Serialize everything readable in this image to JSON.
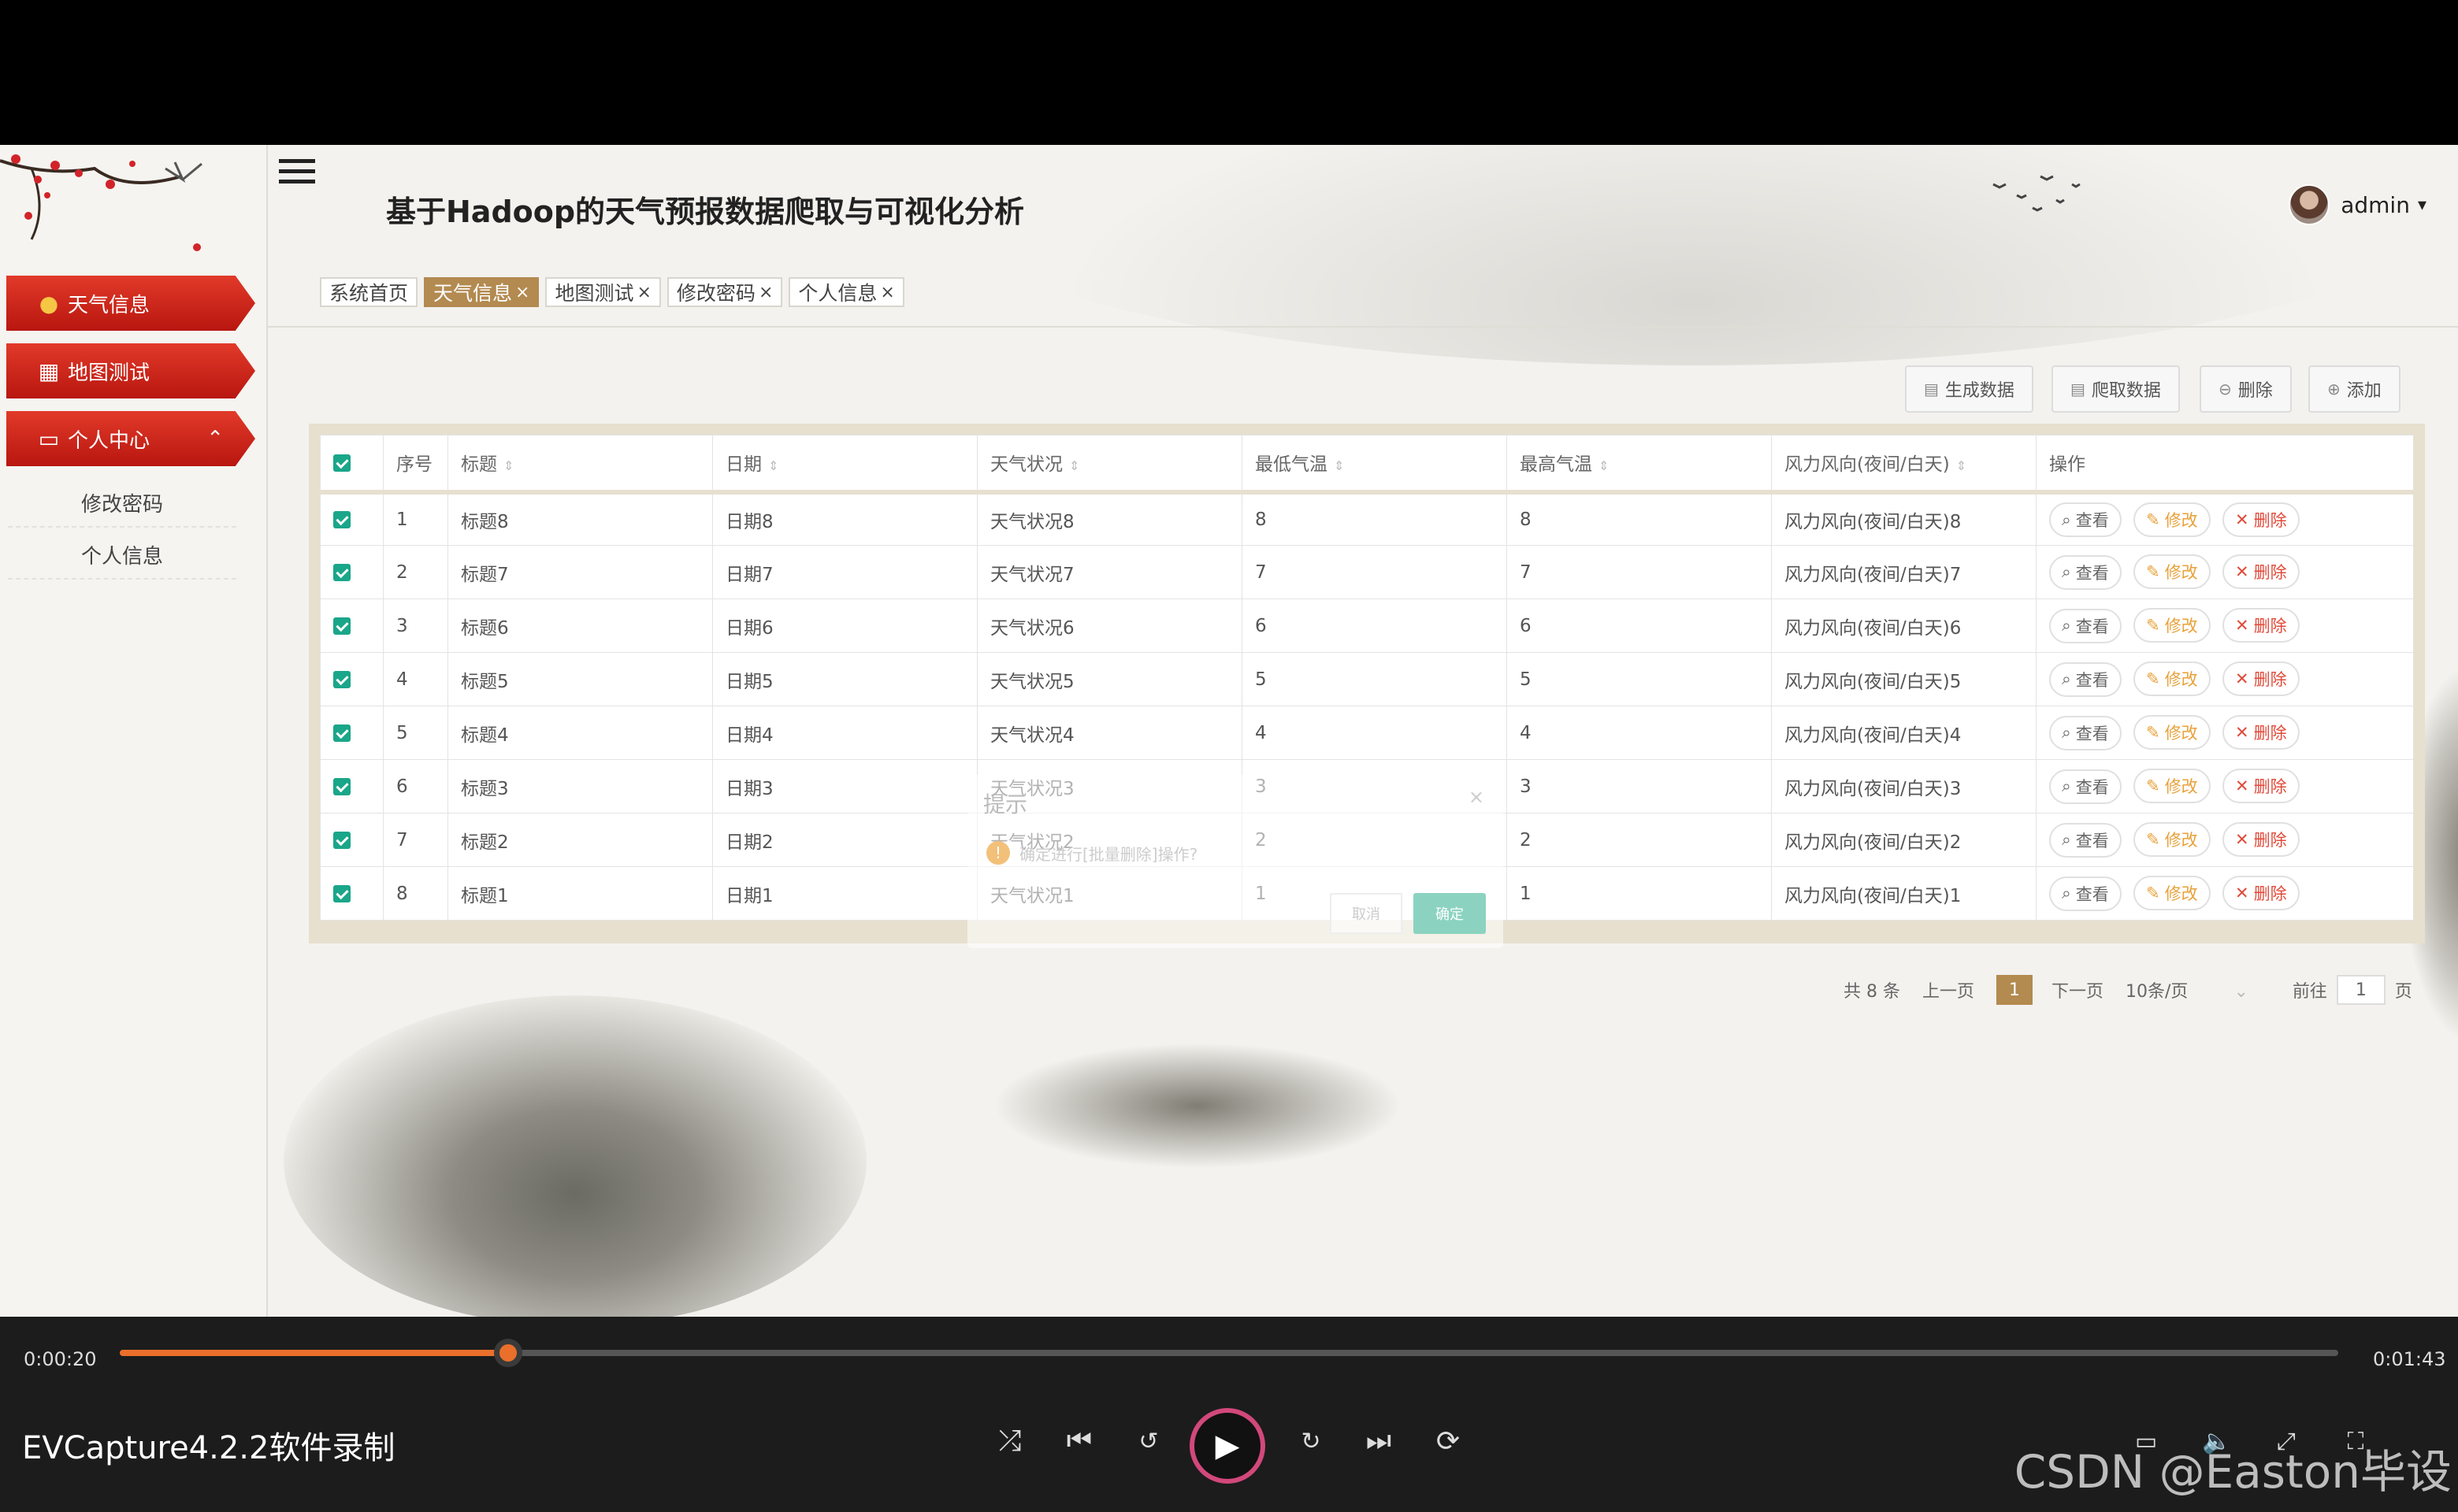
{
  "app_title": "基于Hadoop的天气预报数据爬取与可视化分析",
  "user": {
    "name": "admin",
    "dropdown_icon": "▾"
  },
  "sidebar": {
    "items": [
      {
        "label": "天气信息",
        "icon": "user-icon"
      },
      {
        "label": "地图测试",
        "icon": "grid-icon"
      },
      {
        "label": "个人中心",
        "icon": "calendar-icon",
        "arrow": "^"
      }
    ],
    "subitems": [
      {
        "label": "修改密码"
      },
      {
        "label": "个人信息"
      }
    ]
  },
  "tabs": [
    {
      "label": "系统首页",
      "closable": false
    },
    {
      "label": "天气信息",
      "closable": true,
      "active": true
    },
    {
      "label": "地图测试",
      "closable": true
    },
    {
      "label": "修改密码",
      "closable": true
    },
    {
      "label": "个人信息",
      "closable": true
    }
  ],
  "toolbar": {
    "generate": "生成数据",
    "crawl": "爬取数据",
    "delete": "删除",
    "add": "添加"
  },
  "table": {
    "headers": [
      "序号",
      "标题",
      "日期",
      "天气状况",
      "最低气温",
      "最高气温",
      "风力风向(夜间/白天)",
      "操作"
    ],
    "rows": [
      {
        "no": "1",
        "title": "标题8",
        "date": "日期8",
        "weather": "天气状况8",
        "min": "8",
        "max": "8",
        "wind": "风力风向(夜间/白天)8"
      },
      {
        "no": "2",
        "title": "标题7",
        "date": "日期7",
        "weather": "天气状况7",
        "min": "7",
        "max": "7",
        "wind": "风力风向(夜间/白天)7"
      },
      {
        "no": "3",
        "title": "标题6",
        "date": "日期6",
        "weather": "天气状况6",
        "min": "6",
        "max": "6",
        "wind": "风力风向(夜间/白天)6"
      },
      {
        "no": "4",
        "title": "标题5",
        "date": "日期5",
        "weather": "天气状况5",
        "min": "5",
        "max": "5",
        "wind": "风力风向(夜间/白天)5"
      },
      {
        "no": "5",
        "title": "标题4",
        "date": "日期4",
        "weather": "天气状况4",
        "min": "4",
        "max": "4",
        "wind": "风力风向(夜间/白天)4"
      },
      {
        "no": "6",
        "title": "标题3",
        "date": "日期3",
        "weather": "天气状况3",
        "min": "3",
        "max": "3",
        "wind": "风力风向(夜间/白天)3"
      },
      {
        "no": "7",
        "title": "标题2",
        "date": "日期2",
        "weather": "天气状况2",
        "min": "2",
        "max": "2",
        "wind": "风力风向(夜间/白天)2"
      },
      {
        "no": "8",
        "title": "标题1",
        "date": "日期1",
        "weather": "天气状况1",
        "min": "1",
        "max": "1",
        "wind": "风力风向(夜间/白天)1"
      }
    ],
    "actions": {
      "view": "查看",
      "edit": "修改",
      "delete": "删除"
    }
  },
  "dialog": {
    "title": "提示",
    "message": "确定进行[批量删除]操作?",
    "cancel": "取消",
    "confirm": "确定"
  },
  "pager": {
    "total": "共 8 条",
    "prev": "上一页",
    "current": "1",
    "next": "下一页",
    "page_size": "10条/页",
    "goto_label": "前往",
    "goto_value": "1",
    "page_suffix": "页"
  },
  "player": {
    "elapsed": "0:00:20",
    "duration": "0:01:43",
    "progress": 0.175,
    "watermark": "EVCapture4.2.2软件录制",
    "csdn": "CSDN @Easton毕设"
  },
  "colors": {
    "sidebar_red": "#c81e14",
    "tab_active": "#b38a50",
    "check_green": "#1aa689",
    "progress_orange": "#e96f2b",
    "play_ring": "#d2487b"
  }
}
